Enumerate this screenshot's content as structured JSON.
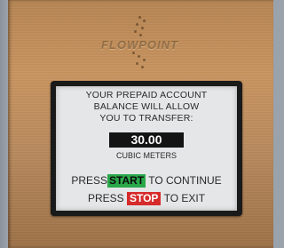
{
  "device": {
    "brand": "FLOWPOINT"
  },
  "screen": {
    "line1": "YOUR PREPAID ACCOUNT",
    "line2": "BALANCE WILL ALLOW",
    "line3": "YOU TO TRANSFER:",
    "amount": "30.00",
    "unit": "CUBIC METERS",
    "start_prefix": "PRESS",
    "start_key": "START",
    "start_suffix": "TO CONTINUE",
    "stop_prefix": "PRESS",
    "stop_key": "STOP",
    "stop_suffix": "TO EXIT"
  },
  "colors": {
    "start_key": "#2aa84a",
    "stop_key": "#d62b2b",
    "panel": "#c8935e",
    "screen": "#e4e6e8"
  }
}
